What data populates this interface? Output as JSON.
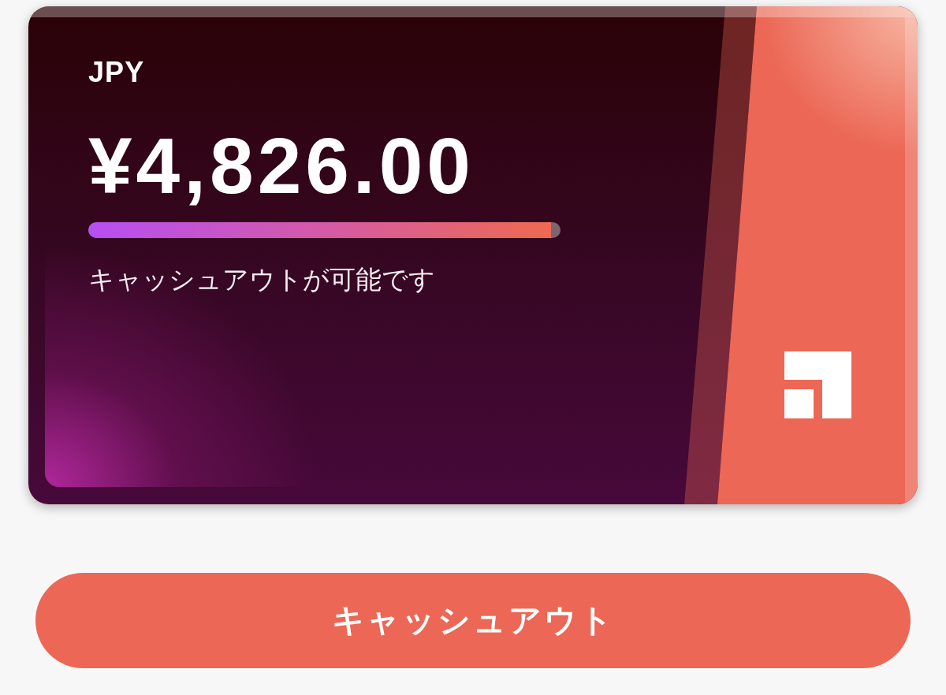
{
  "card": {
    "currency": "JPY",
    "balance": "¥4,826.00",
    "progress": {
      "level": 0.98
    },
    "status": "キャッシュアウトが可能です"
  },
  "cashout_button": {
    "label": "キャッシュアウト"
  }
}
